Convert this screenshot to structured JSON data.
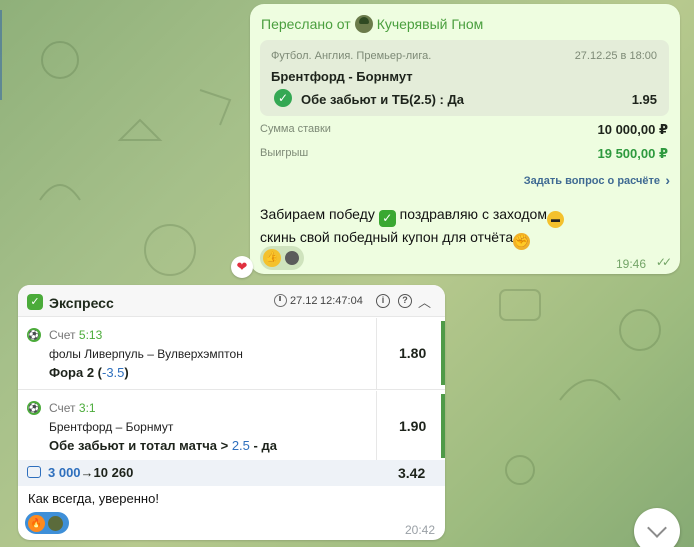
{
  "forwarded": {
    "prefix": "Переслано от",
    "author": "Кучерявый Гном",
    "coupon": {
      "league": "Футбол. Англия. Премьер-лига.",
      "date": "27.12.25 в 18:00",
      "match": "Брентфорд - Борнмут",
      "bet": "Обе забьют и ТБ(2.5) : Да",
      "odds": "1.95"
    },
    "stake_label": "Сумма ставки",
    "stake_value": "10 000,00 ₽",
    "win_label": "Выигрыш",
    "win_value": "19 500,00 ₽",
    "ask_link": "Задать вопрос о расчёте",
    "message_line1_a": "Забираем победу",
    "message_line1_b": "поздравляю с заходом",
    "message_line2": "скинь свой победный купон для отчёта",
    "time": "19:46",
    "status_ticks": "✓✓"
  },
  "express": {
    "title": "Экспресс",
    "date": "27.12",
    "time": "12:47:04",
    "legs": [
      {
        "score_label": "Счет",
        "score_value": "5:13",
        "teams": "фолы Ливерпуль – Вулверхэмптон",
        "market_prefix": "Фора 2 (",
        "market_highlight": "-3.5",
        "market_suffix": ")",
        "odds": "1.80"
      },
      {
        "score_label": "Счет",
        "score_value": "3:1",
        "teams": "Брентфорд – Борнмут",
        "market_prefix": "Обе забьют и тотал матча >",
        "market_highlight": "2.5",
        "market_suffix": "- да",
        "odds": "1.90"
      }
    ],
    "sum_stake": "3 000",
    "sum_arrow": "→",
    "sum_win": "10 260",
    "total_odds": "3.42",
    "message": "Как всегда, уверенно!",
    "msg_time": "20:42"
  },
  "icons": {
    "reaction_heart": "heart-icon",
    "reaction_thumbs": "thumbs-up-icon",
    "reaction_fire": "fire-icon",
    "scroll_down": "chevron-down-icon"
  },
  "colors": {
    "forward_green": "#4a9f3e",
    "win_green": "#2e9a3e",
    "link_blue": "#3f6a93",
    "express_green": "#4bab3a",
    "highlight_blue": "#2e6fbd"
  }
}
